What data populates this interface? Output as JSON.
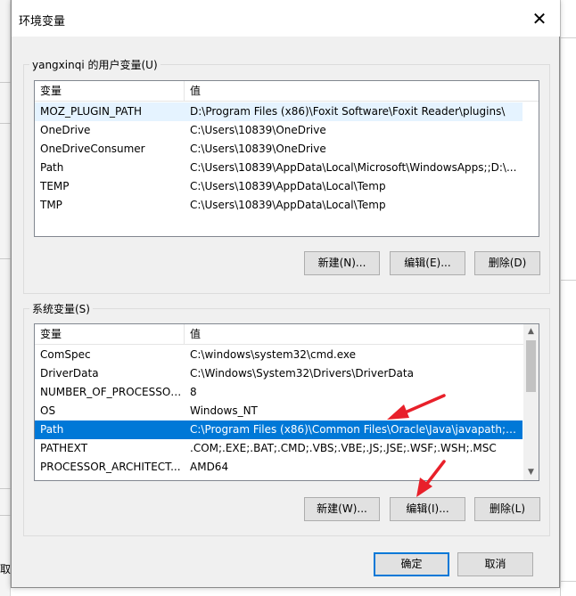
{
  "window": {
    "title": "环境变量",
    "close_glyph": "✕"
  },
  "user_vars": {
    "group_label": "yangxinqi 的用户变量(U)",
    "headers": {
      "name": "变量",
      "value": "值"
    },
    "rows": [
      {
        "name": "MOZ_PLUGIN_PATH",
        "value": "D:\\Program Files (x86)\\Foxit Software\\Foxit Reader\\plugins\\"
      },
      {
        "name": "OneDrive",
        "value": "C:\\Users\\10839\\OneDrive"
      },
      {
        "name": "OneDriveConsumer",
        "value": "C:\\Users\\10839\\OneDrive"
      },
      {
        "name": "Path",
        "value": "C:\\Users\\10839\\AppData\\Local\\Microsoft\\WindowsApps;;D:\\..."
      },
      {
        "name": "TEMP",
        "value": "C:\\Users\\10839\\AppData\\Local\\Temp"
      },
      {
        "name": "TMP",
        "value": "C:\\Users\\10839\\AppData\\Local\\Temp"
      }
    ],
    "buttons": {
      "new": "新建(N)...",
      "edit": "编辑(E)...",
      "delete": "删除(D)"
    }
  },
  "system_vars": {
    "group_label": "系统变量(S)",
    "headers": {
      "name": "变量",
      "value": "值"
    },
    "rows": [
      {
        "name": "ComSpec",
        "value": "C:\\windows\\system32\\cmd.exe"
      },
      {
        "name": "DriverData",
        "value": "C:\\Windows\\System32\\Drivers\\DriverData"
      },
      {
        "name": "NUMBER_OF_PROCESSORS",
        "value": "8"
      },
      {
        "name": "OS",
        "value": "Windows_NT"
      },
      {
        "name": "Path",
        "value": "C:\\Program Files (x86)\\Common Files\\Oracle\\Java\\javapath;C:..."
      },
      {
        "name": "PATHEXT",
        "value": ".COM;.EXE;.BAT;.CMD;.VBS;.VBE;.JS;.JSE;.WSF;.WSH;.MSC"
      },
      {
        "name": "PROCESSOR_ARCHITECT...",
        "value": "AMD64"
      }
    ],
    "selected_index": 4,
    "buttons": {
      "new": "新建(W)...",
      "edit": "编辑(I)...",
      "delete": "删除(L)"
    }
  },
  "footer": {
    "ok": "确定",
    "cancel": "取消"
  },
  "background": {
    "left_fragment": "取"
  },
  "colors": {
    "selection": "#0078d7",
    "annotation_arrow": "#e8202a",
    "primary_border": "#0078d7"
  }
}
